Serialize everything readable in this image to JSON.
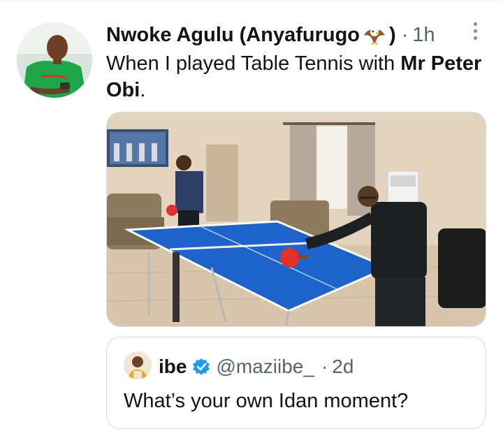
{
  "tweet": {
    "author_name": "Nwoke Agulu (Anyafurugo",
    "author_name_close": ")",
    "author_emoji": "eagle-emoji",
    "separator": "·",
    "time": "1h",
    "text_part1": "When I played Table Tennis with ",
    "text_bold": "Mr Peter Obi",
    "text_end": ".",
    "media_description_icon": "photo"
  },
  "quote": {
    "author_name": "ibe",
    "handle": "@maziibe_",
    "separator": "·",
    "time": "2d",
    "text": "What’s your own Idan moment?",
    "verified": true
  },
  "colors": {
    "text_primary": "#0f1419",
    "text_secondary": "#536471",
    "verified_blue": "#1d9bf0",
    "table_blue": "#1e63c9",
    "border": "#cfd9de"
  }
}
